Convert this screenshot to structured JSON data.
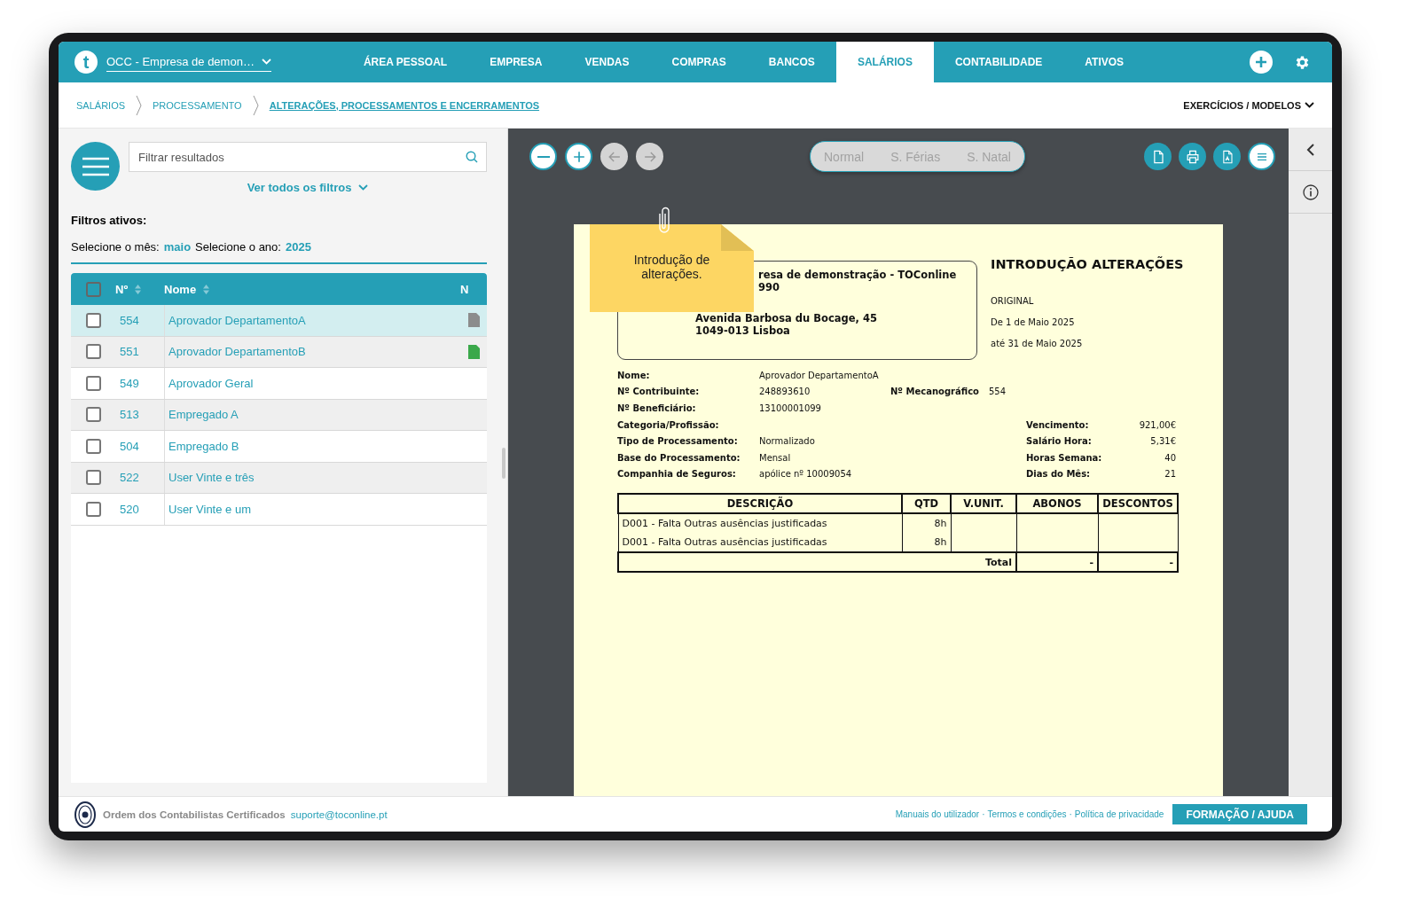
{
  "topbar": {
    "logo": "t",
    "company": "OCC - Empresa de demon…",
    "tabs": [
      {
        "label": "ÁREA PESSOAL",
        "selected": false
      },
      {
        "label": "EMPRESA",
        "selected": false
      },
      {
        "label": "VENDAS",
        "selected": false
      },
      {
        "label": "COMPRAS",
        "selected": false
      },
      {
        "label": "BANCOS",
        "selected": false
      },
      {
        "label": "SALÁRIOS",
        "selected": true
      },
      {
        "label": "CONTABILIDADE",
        "selected": false
      },
      {
        "label": "ATIVOS",
        "selected": false
      }
    ]
  },
  "breadcrumb": [
    {
      "label": "SALÁRIOS",
      "current": false
    },
    {
      "label": "PROCESSAMENTO",
      "current": false
    },
    {
      "label": "ALTERAÇÕES, PROCESSAMENTOS E ENCERRAMENTOS",
      "current": true
    }
  ],
  "exercises_menu": "EXERCÍCIOS / MODELOS",
  "filters": {
    "search": {
      "placeholder": "Filtrar resultados"
    },
    "see_all": "Ver todos os filtros",
    "active_title": "Filtros ativos:",
    "active": [
      {
        "label": "Selecione o mês:",
        "value": "maio"
      },
      {
        "label": "Selecione o ano:",
        "value": "2025"
      }
    ]
  },
  "table": {
    "header_checkbox": {
      "checked": false
    },
    "columns": [
      "Nº",
      "Nome",
      "N"
    ],
    "rows": [
      {
        "checked": false,
        "selected": true,
        "number": "554",
        "name": "Aprovador DepartamentoA",
        "color": "#8c8c8c"
      },
      {
        "checked": false,
        "selected": false,
        "number": "551",
        "name": "Aprovador DepartamentoB",
        "color": "#3aa84a"
      },
      {
        "checked": false,
        "selected": false,
        "number": "549",
        "name": "Aprovador Geral"
      },
      {
        "checked": false,
        "selected": false,
        "number": "513",
        "name": "Empregado A"
      },
      {
        "checked": false,
        "selected": false,
        "number": "504",
        "name": "Empregado B"
      },
      {
        "checked": false,
        "selected": false,
        "number": "522",
        "name": "User Vinte e três"
      },
      {
        "checked": false,
        "selected": false,
        "number": "520",
        "name": "User Vinte e um"
      }
    ]
  },
  "viewer": {
    "nav_buttons": [
      {
        "kind": "zoom-out",
        "disabled": false
      },
      {
        "kind": "zoom-in",
        "disabled": false
      },
      {
        "kind": "back",
        "disabled": true
      },
      {
        "kind": "forward",
        "disabled": true
      }
    ],
    "modes": [
      {
        "label": "Normal",
        "disabled": true
      },
      {
        "label": "S. Férias",
        "disabled": true
      },
      {
        "label": "S. Natal",
        "disabled": true
      }
    ],
    "actions": [
      {
        "kind": "document"
      },
      {
        "kind": "print"
      },
      {
        "kind": "pdf"
      },
      {
        "kind": "menu"
      }
    ],
    "note": "Introdução de alterações.",
    "document": {
      "address": [
        "resa de demonstração - TOConline",
        "990",
        "Avenida Barbosa du Bocage, 45",
        "1049-013 Lisboa"
      ],
      "title": "INTRODUÇÃO ALTERAÇÕES",
      "meta": [
        "ORIGINAL",
        "De 1 de Maio 2025",
        "até 31 de Maio 2025"
      ],
      "fields": [
        {
          "kind": "single",
          "label": "Nome:",
          "value": "Aprovador DepartamentoA"
        },
        {
          "kind": "mid",
          "label": "Nº Contribuinte:",
          "value": "248893610",
          "label2": "Nº Mecanográfico",
          "value2": "554"
        },
        {
          "kind": "single",
          "label": "Nº Beneficiário:",
          "value": "13100001099"
        },
        {
          "kind": "right",
          "label": "Categoria/Profissão:",
          "label2": "Vencimento:",
          "value2": "921,00€"
        },
        {
          "kind": "right",
          "label": "Tipo de Processamento:",
          "value": "Normalizado",
          "label2": "Salário Hora:",
          "value2": "5,31€"
        },
        {
          "kind": "right",
          "label": "Base do Processamento:",
          "value": "Mensal",
          "label2": "Horas Semana:",
          "value2": "40"
        },
        {
          "kind": "right",
          "label": "Companhia de Seguros:",
          "value": " apólice nº 10009054",
          "label2": "Dias do Mês:",
          "value2": "21"
        }
      ],
      "columns": [
        "DESCRIÇÃO",
        "QTD",
        "V.UNIT.",
        "ABONOS",
        "DESCONTOS"
      ],
      "lines": [
        {
          "description": "D001 - Falta Outras ausências justificadas",
          "qty": "8h"
        },
        {
          "description": "D001 - Falta Outras ausências justificadas",
          "qty": "8h"
        }
      ],
      "total": {
        "label": "Total",
        "allowances": "-",
        "deductions": "-"
      }
    }
  },
  "footer": {
    "org": "Ordem dos Contabilistas Certificados",
    "email": "suporte@toconline.pt",
    "links": [
      "Manuais do utilizador",
      "Termos e condições",
      "Política de privacidade"
    ],
    "separators": [
      "·",
      "·"
    ],
    "help_button": "FORMAÇÃO / AJUDA"
  }
}
